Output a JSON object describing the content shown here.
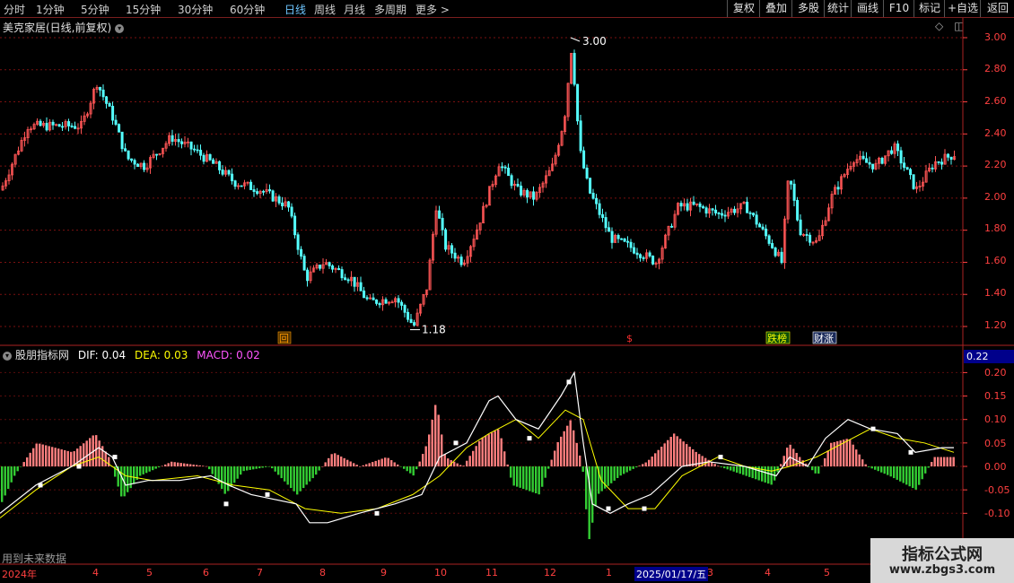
{
  "toolbar": {
    "timeframes": [
      "分时",
      "1分钟",
      "5分钟",
      "15分钟",
      "30分钟",
      "60分钟",
      "日线",
      "周线",
      "月线",
      "多周期",
      "更多 >"
    ],
    "active": "日线",
    "right_buttons": [
      "复权",
      "叠加",
      "多股",
      "统计",
      "画线",
      "F10",
      "标记",
      "+自选",
      "返回"
    ]
  },
  "main_chart": {
    "title": "美克家居(日线,前复权)",
    "y_ticks": [
      "3.00",
      "2.80",
      "2.60",
      "2.40",
      "2.20",
      "2.00",
      "1.80",
      "1.60",
      "1.40",
      "1.20"
    ],
    "high_label": "3.00",
    "low_label": "1.18",
    "event_markers": [
      "回",
      "$",
      "跌榜",
      "财涨"
    ]
  },
  "indicator": {
    "name": "股朋指标网",
    "dif_label": "DIF: 0.04",
    "dea_label": "DEA: 0.03",
    "macd_label": "MACD: 0.02",
    "current_value": "0.22",
    "y_ticks": [
      "0.20",
      "0.15",
      "0.10",
      "0.05",
      "0.00",
      "-0.05",
      "-0.10"
    ],
    "footer_note": "用到未来数据"
  },
  "date_axis": {
    "labels": [
      "2024年",
      "4",
      "5",
      "6",
      "7",
      "8",
      "9",
      "10",
      "11",
      "12",
      "1",
      "2025/01/17/五",
      "3",
      "4",
      "5"
    ]
  },
  "watermark": {
    "title": "指标公式网",
    "url": "www.zbgs3.com"
  },
  "colors": {
    "up": "#ff5555",
    "down": "#54ffff",
    "macd_pos": "#ff7f7f",
    "macd_neg": "#33cc33",
    "dif": "#ffffff",
    "dea": "#ffff00",
    "axis": "#ff4040"
  }
}
